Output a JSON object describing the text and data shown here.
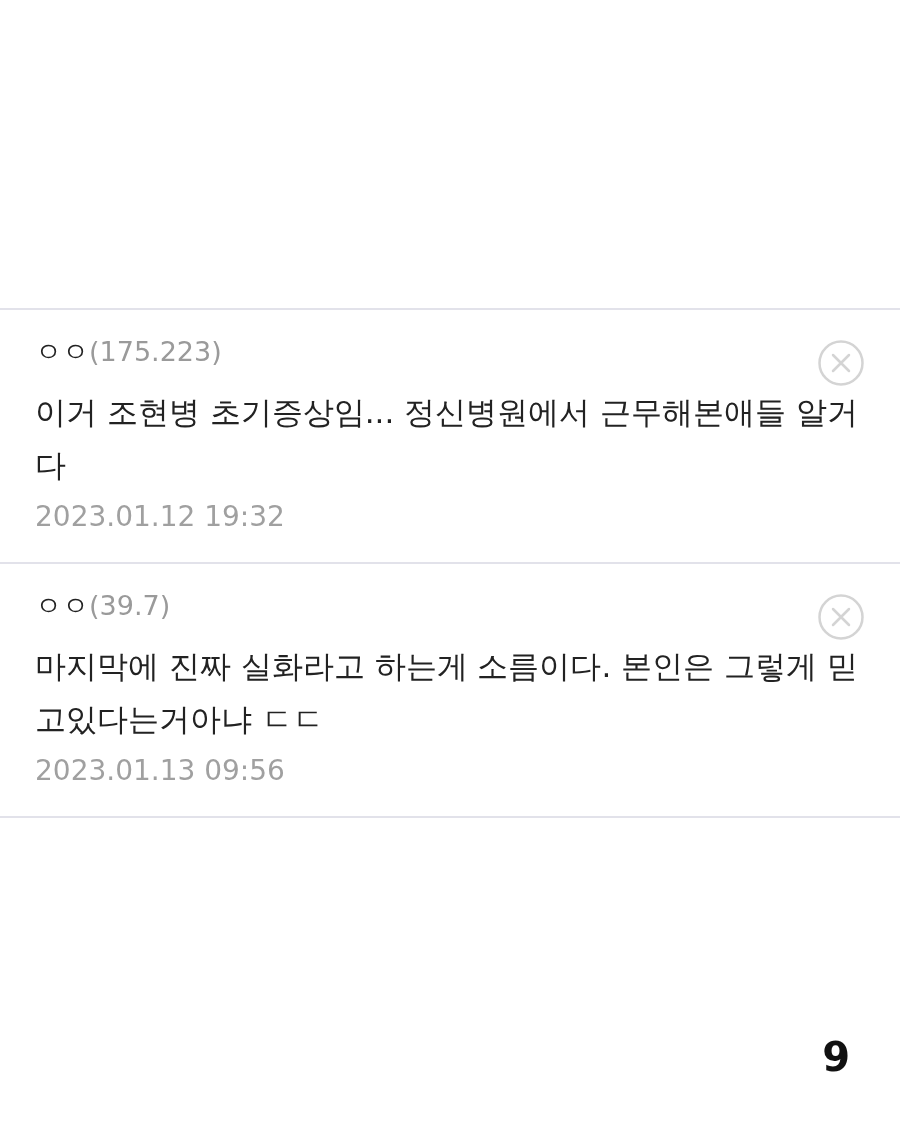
{
  "comments": [
    {
      "author": "ㅇㅇ",
      "ip": "(175.223)",
      "text": "이거 조현병 초기증상임... 정신병원에서 근무해본애들 알거다",
      "date": "2023.01.12 19:32"
    },
    {
      "author": "ㅇㅇ",
      "ip": "(39.7)",
      "text": "마지막에 진짜 실화라고 하는게 소름이다. 본인은 그렇게 믿고있다는거아냐 ㄷㄷ",
      "date": "2023.01.13 09:56"
    }
  ],
  "page_number": "9"
}
